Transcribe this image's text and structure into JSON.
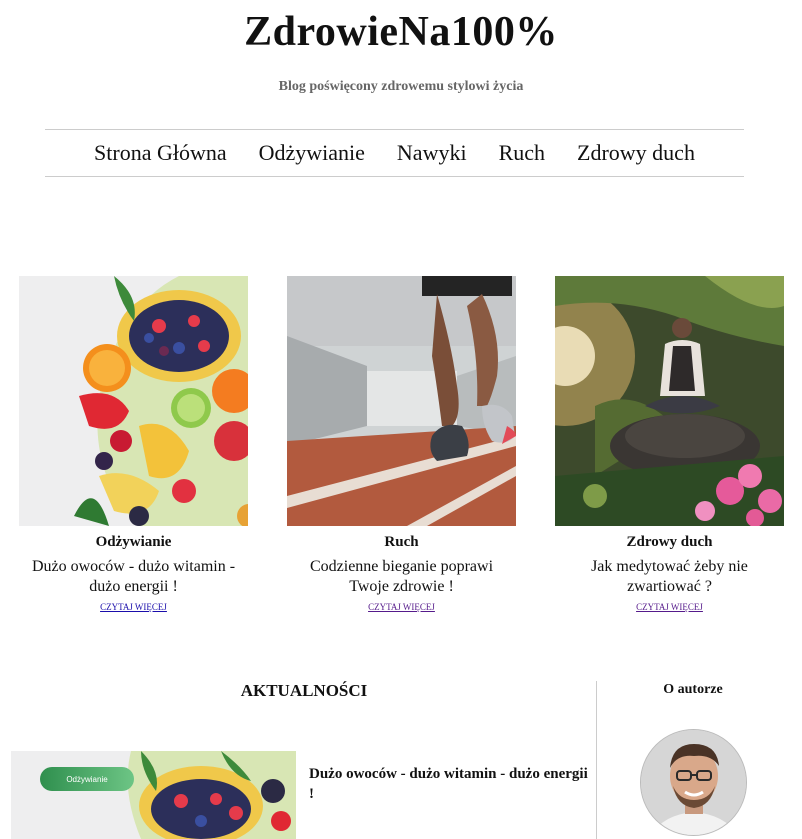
{
  "site": {
    "title": "ZdrowieNa100%",
    "tagline": "Blog poświęcony zdrowemu stylowi życia"
  },
  "nav": {
    "items": [
      "Strona Główna",
      "Odżywianie",
      "Nawyki",
      "Ruch",
      "Zdrowy duch"
    ]
  },
  "cards": [
    {
      "category": "Odżywianie",
      "headline": "Dużo owoców - dużo witamin - dużo energii !",
      "more": "CZYTAJ WIĘCEJ",
      "image": "fruit-platter-image"
    },
    {
      "category": "Ruch",
      "headline": "Codzienne bieganie poprawi Twoje zdrowie !",
      "more": "CZYTAJ WIĘCEJ",
      "image": "running-legs-image"
    },
    {
      "category": "Zdrowy duch",
      "headline": "Jak medytować żeby nie zwartiować ?",
      "more": "CZYTAJ WIĘCEJ",
      "image": "meditation-image"
    }
  ],
  "news": {
    "title": "AKTUALNOŚCI",
    "items": [
      {
        "badge": "Odżywianie",
        "headline": "Dużo owoców - dużo witamin - dużo energii !"
      }
    ]
  },
  "about": {
    "title": "O autorze"
  },
  "colors": {
    "link": "#1a0dab",
    "visited": "#551a8b",
    "badge": "#3a9a5a",
    "divider": "#cccccc"
  }
}
